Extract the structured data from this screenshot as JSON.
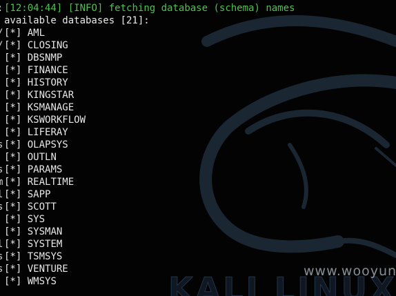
{
  "terminal": {
    "log": {
      "timestamp": "[12:04:44]",
      "level": "[INFO]",
      "message": "fetching database (schema) names"
    },
    "header": "available databases [21]:",
    "marker": "[*]",
    "databases": [
      "AML",
      "CLOSING",
      "DBSNMP",
      "FINANCE",
      "HISTORY",
      "KINGSTAR",
      "KSMANAGE",
      "KSWORKFLOW",
      "LIFERAY",
      "OLAPSYS",
      "OUTLN",
      "PARAMS",
      "REALTIME",
      "SAPP",
      "SCOTT",
      "SYS",
      "SYSMAN",
      "SYSTEM",
      "TSMSYS",
      "VENTURE",
      "WMSYS"
    ],
    "left_edge_chars": [
      ":",
      "/",
      "/",
      "s",
      "s",
      "m",
      "l",
      "s",
      "l",
      "s",
      "s"
    ]
  },
  "wallpaper": {
    "logo": "KALI LINUX",
    "icon": "kali-dragon-icon"
  },
  "watermark": "www.wooyun.org",
  "colors": {
    "background": "#030303",
    "text": "#e8e8e8",
    "log_green": "#4ec24e",
    "dragon": "#1b2633"
  }
}
